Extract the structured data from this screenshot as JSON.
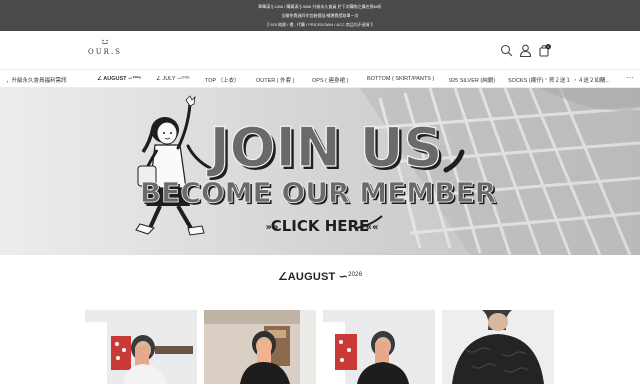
{
  "announcement": {
    "line1": "單筆滿＄1288 / 購買滿＄3888 升級永久會員 於下次購物之擴名預88折",
    "line2": "全聯免費週四作包裝價延/補運費提取單一次",
    "line3": "【 925 純銀 / 禮 - 代購 / PRICEDOWN / ACC 商品均不退貨 】"
  },
  "header": {
    "logo_text": "OUR.S",
    "cart_count": "0",
    "icons": [
      "search-icon",
      "user-icon",
      "bag-icon"
    ]
  },
  "nav": {
    "items": [
      {
        "label": "，升級永久會員福利需訊",
        "bold": false
      },
      {
        "label": "∠ AUGUST ∽²⁰²⁶",
        "bold": true
      },
      {
        "label": "∠ JULY ∽²⁰²⁶",
        "bold": false
      },
      {
        "label": "TOP （上衣）",
        "bold": false
      },
      {
        "label": "OUTER ( 外套 )",
        "bold": false
      },
      {
        "label": "OPS ( 連身裙 )",
        "bold": false
      },
      {
        "label": "BOTTOM ( SKIRT/PANTS )",
        "bold": false
      },
      {
        "label": "925 SILVER (純銀)",
        "bold": false
      },
      {
        "label": "SOCKS (襪仔) ᐟ 買２送１ ・４送２如購...",
        "bold": false
      }
    ],
    "more_icon": "ellipsis-icon"
  },
  "banner": {
    "headline": "JOIN US",
    "subhead": "BECOME OUR MEMBER",
    "cta": "CLICK HERE",
    "cta_prefix": "»»",
    "cta_suffix": "««"
  },
  "section": {
    "title": "∠AUGUST ∽",
    "title_sup": "2026"
  },
  "products": [
    {
      "alt": "product-photo-1"
    },
    {
      "alt": "product-photo-2"
    },
    {
      "alt": "product-photo-3"
    },
    {
      "alt": "product-photo-4"
    }
  ],
  "colors": {
    "announcement_bg": "#4a4a4a",
    "banner_bg": "#d9d9d9",
    "headline_fill": "#6a6a6a",
    "headline_shadow": "#1f1f1f"
  }
}
